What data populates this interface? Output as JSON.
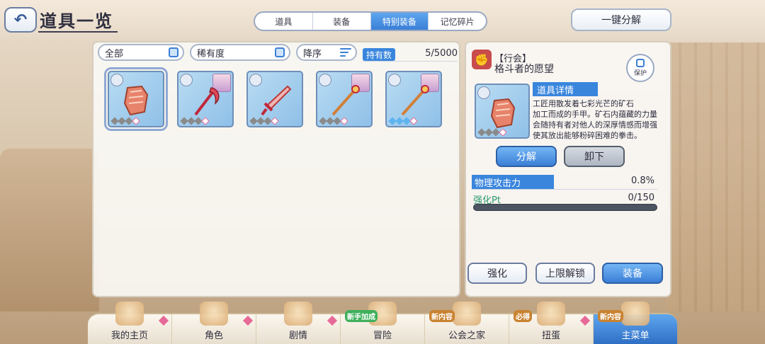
{
  "header": {
    "title": "道具一览",
    "bulk_action_label": "一键分解"
  },
  "top_tabs": [
    {
      "label": "道具",
      "active": false
    },
    {
      "label": "装备",
      "active": false
    },
    {
      "label": "特别装备",
      "active": true
    },
    {
      "label": "记忆碎片",
      "active": false
    }
  ],
  "filters": {
    "category": "全部",
    "rarity": "稀有度",
    "sort": "降序",
    "owned_label": "持有数",
    "owned_count": "5/5000"
  },
  "inventory": [
    {
      "name": "fist-gauntlet-item",
      "has_character": false,
      "stars": [
        "gray",
        "gray",
        "gray",
        "pink"
      ],
      "selected": true
    },
    {
      "name": "crimson-scythe-item",
      "has_character": true,
      "stars": [
        "gray",
        "gray",
        "gray",
        "pink"
      ],
      "selected": false
    },
    {
      "name": "red-sword-item",
      "has_character": false,
      "stars": [
        "gray",
        "gray",
        "gray",
        "pink"
      ],
      "selected": false
    },
    {
      "name": "flame-staff-item",
      "has_character": true,
      "stars": [
        "gray",
        "gray",
        "gray",
        "pink"
      ],
      "selected": false
    },
    {
      "name": "blue-staff-item",
      "has_character": true,
      "stars": [
        "blue",
        "blue",
        "blue",
        "pink"
      ],
      "selected": false
    }
  ],
  "detail": {
    "guild_tag": "【行会】",
    "item_name": "格斗者的愿望",
    "protect_label": "保护",
    "section_label": "道具详情",
    "description_lines": [
      "工匠用散发着七彩光芒的矿石",
      "加工而成的手甲。矿石内蕴藏的力量",
      "会随持有者对他人的深厚情感而增强",
      "使其放出能够粉碎困难的拳击。"
    ],
    "dismantle_label": "分解",
    "unequip_label": "卸下",
    "stat_label": "物理攻击力",
    "stat_value": "0.8%",
    "enhance_label": "强化Pt",
    "enhance_value": "0/150",
    "enhance_progress": 0.0
  },
  "actions": {
    "enhance_label": "强化",
    "limit_break_label": "上限解锁",
    "equip_label": "装备"
  },
  "bottom_nav": [
    {
      "label": "我的主页",
      "badge": "",
      "active": false
    },
    {
      "label": "角色",
      "badge": "",
      "active": false
    },
    {
      "label": "剧情",
      "badge": "",
      "active": false
    },
    {
      "label": "冒险",
      "badge": "新手加成",
      "active": false
    },
    {
      "label": "公会之家",
      "badge": "新内容",
      "active": false
    },
    {
      "label": "扭蛋",
      "badge": "必得",
      "active": false
    },
    {
      "label": "主菜单",
      "badge": "新内容",
      "active": true
    }
  ],
  "colors": {
    "accent_blue": "#3a86dd",
    "gem_pink": "#e66a97",
    "enhance_green": "#2c9a6c"
  }
}
